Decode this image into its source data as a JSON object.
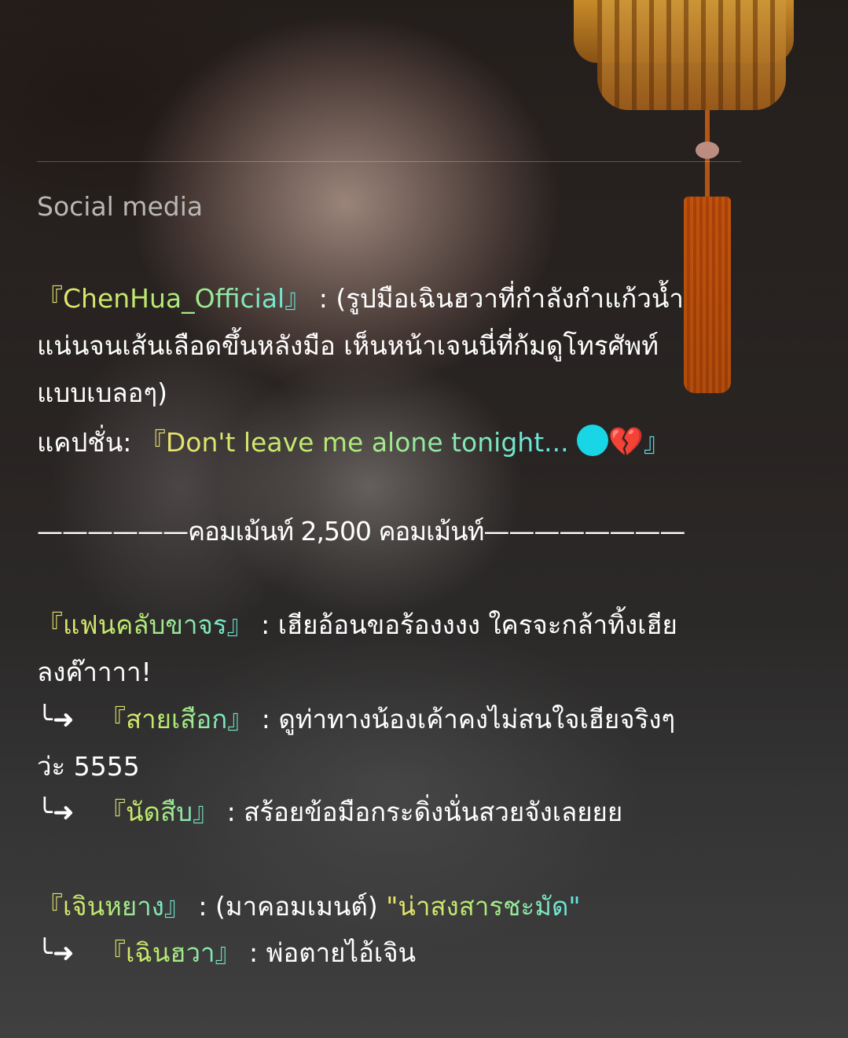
{
  "heading": "Social media",
  "post": {
    "author": "『ChenHua_Official』",
    "description_line1": " : (รูปมือเฉินฮวาที่กำลังกำแก้วน้ำ",
    "description_line2": "แน่นจนเส้นเลือดขึ้นหลังมือ เห็นหน้าเจนนี่ที่ก้มดูโทรศัพท์",
    "description_line3": "แบบเบลอๆ)",
    "caption_label": "แคปชั่น: ",
    "caption_text": "『Don't leave me alone tonight...",
    "caption_heart": "💔",
    "caption_close": "』"
  },
  "comments_divider": "——————คอมเม้นท์ 2,500 คอมเม้นท์————————",
  "comments": [
    {
      "user": "『แฟนคลับขาจร』",
      "text_line1": " : เฮียอ้อนขอร้องงงง ใครจะกล้าทิ้งเฮีย",
      "text_line2": "ลงค๊าาาา!",
      "replies": [
        {
          "arrow": "╰➜",
          "user": "『สายเสือก』",
          "text_line1": " : ดูท่าทางน้องเค้าคงไม่สนใจเฮียจริงๆ",
          "text_line2": "ว่ะ 5555"
        },
        {
          "arrow": "╰➜",
          "user": "『นัดสืบ』",
          "text_line1": " : สร้อยข้อมือกระดิ่งนั่นสวยจังเลยยย"
        }
      ]
    },
    {
      "user": "『เจินหยาง』",
      "text_line1": " : (มาคอมเมนต์) ",
      "quote": "\"น่าสงสารชะมัด\"",
      "replies": [
        {
          "arrow": "╰➜",
          "user": "『เฉินฮวา』",
          "text_line1": " : พ่อตายไอ้เจิน"
        }
      ]
    }
  ]
}
